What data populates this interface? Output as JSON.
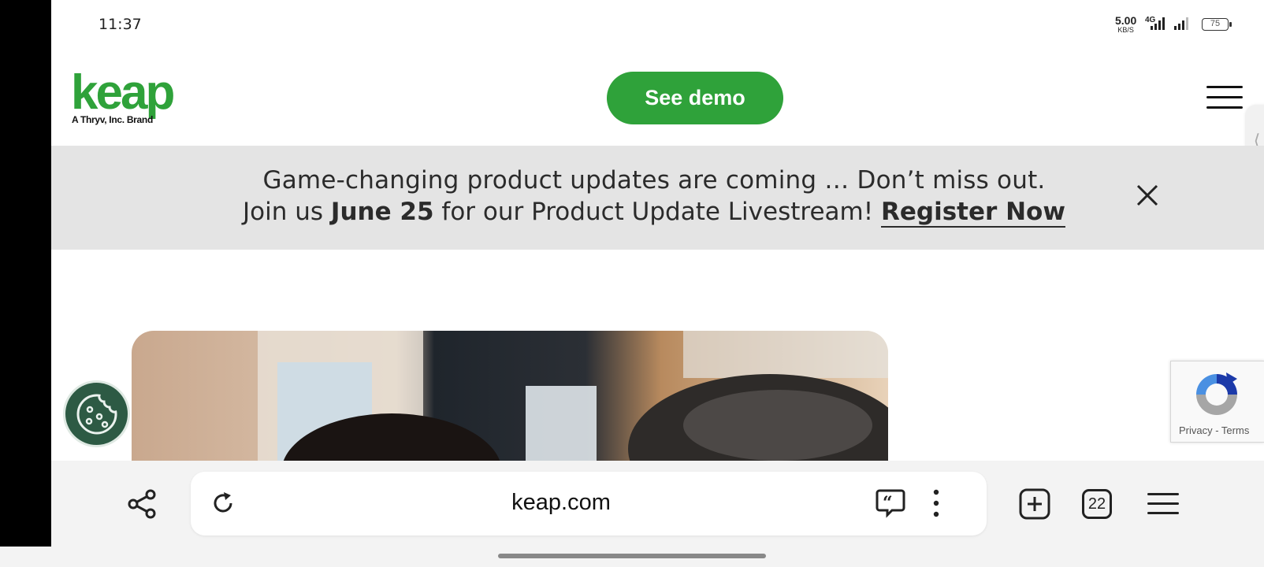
{
  "status_bar": {
    "time": "11:37",
    "net_speed": "5.00",
    "net_speed_unit": "KB/S",
    "net_type": "4G",
    "battery": "75"
  },
  "header": {
    "logo_text": "keap",
    "logo_sub": "A Thryv, Inc. Brand",
    "demo_label": "See demo",
    "brand_color": "#2fa23a"
  },
  "banner": {
    "line1": "Game-changing product updates are coming … Don’t miss out.",
    "line2_prefix": "Join us ",
    "line2_date": "June 25",
    "line2_mid": " for our Product Update Livestream! ",
    "line2_link": "Register Now"
  },
  "recaptcha": {
    "text": "Privacy - Terms"
  },
  "browser": {
    "url": "keap.com",
    "tab_count": "22"
  },
  "icons": [
    "share-icon",
    "reload-icon",
    "quote-icon",
    "more-vert-icon",
    "new-tab-icon",
    "tabs-icon",
    "menu-icon",
    "close-icon",
    "cookie-icon",
    "recaptcha-icon",
    "hamburger-icon"
  ]
}
